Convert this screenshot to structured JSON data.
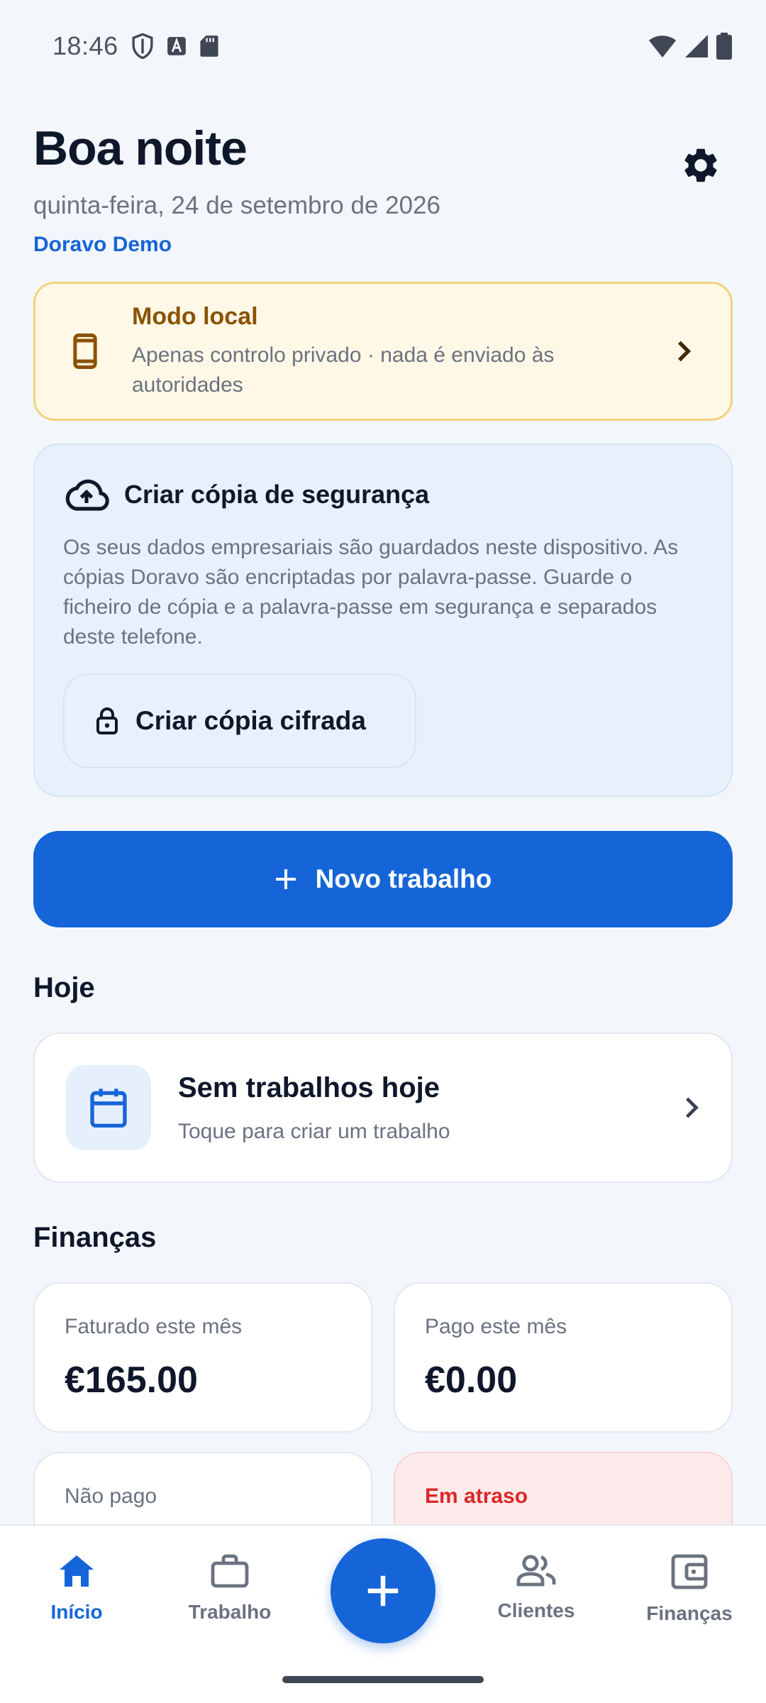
{
  "status_bar": {
    "time": "18:46",
    "icons_left": [
      "shield-icon",
      "font-download-icon",
      "sd-card-icon"
    ],
    "icons_right": [
      "wifi-icon",
      "signal-icon",
      "battery-icon"
    ]
  },
  "header": {
    "greeting": "Boa noite",
    "date": "quinta-feira, 24 de setembro de 2026",
    "company": "Doravo Demo",
    "settings_icon": "gear-icon"
  },
  "local_mode": {
    "title": "Modo local",
    "description": "Apenas controlo privado · nada é enviado às autoridades",
    "icon": "phone-icon",
    "accent": "#8A5200"
  },
  "backup": {
    "title": "Criar cópia de segurança",
    "description": "Os seus dados empresariais são guardados neste dispositivo. As cópias Doravo são encriptadas por palavra-passe. Guarde o ficheiro de cópia e a palavra-passe em segurança e separados deste telefone.",
    "button_label": "Criar cópia cifrada",
    "icon": "cloud-upload-icon",
    "button_icon": "lock-icon"
  },
  "new_job": {
    "label": "Novo trabalho",
    "icon": "plus-icon"
  },
  "today": {
    "section_title": "Hoje",
    "card_title": "Sem trabalhos hoje",
    "card_subtitle": "Toque para criar um trabalho",
    "icon": "calendar-icon"
  },
  "finances": {
    "section_title": "Finanças",
    "cards": [
      {
        "label": "Faturado este mês",
        "value": "€165.00"
      },
      {
        "label": "Pago este mês",
        "value": "€0.00"
      },
      {
        "label": "Não pago",
        "value": ""
      },
      {
        "label": "Em atraso",
        "value": ""
      }
    ]
  },
  "bottom_nav": {
    "items": [
      {
        "label": "Início",
        "icon": "home-icon",
        "active": true
      },
      {
        "label": "Trabalho",
        "icon": "briefcase-icon",
        "active": false
      },
      {
        "label": "Clientes",
        "icon": "people-icon",
        "active": false
      },
      {
        "label": "Finanças",
        "icon": "wallet-icon",
        "active": false
      }
    ],
    "fab_icon": "plus-icon"
  },
  "colors": {
    "primary": "#1565D8",
    "background": "#F3F6FB",
    "warning_bg": "#FFF8E6",
    "danger": "#DC2626"
  }
}
